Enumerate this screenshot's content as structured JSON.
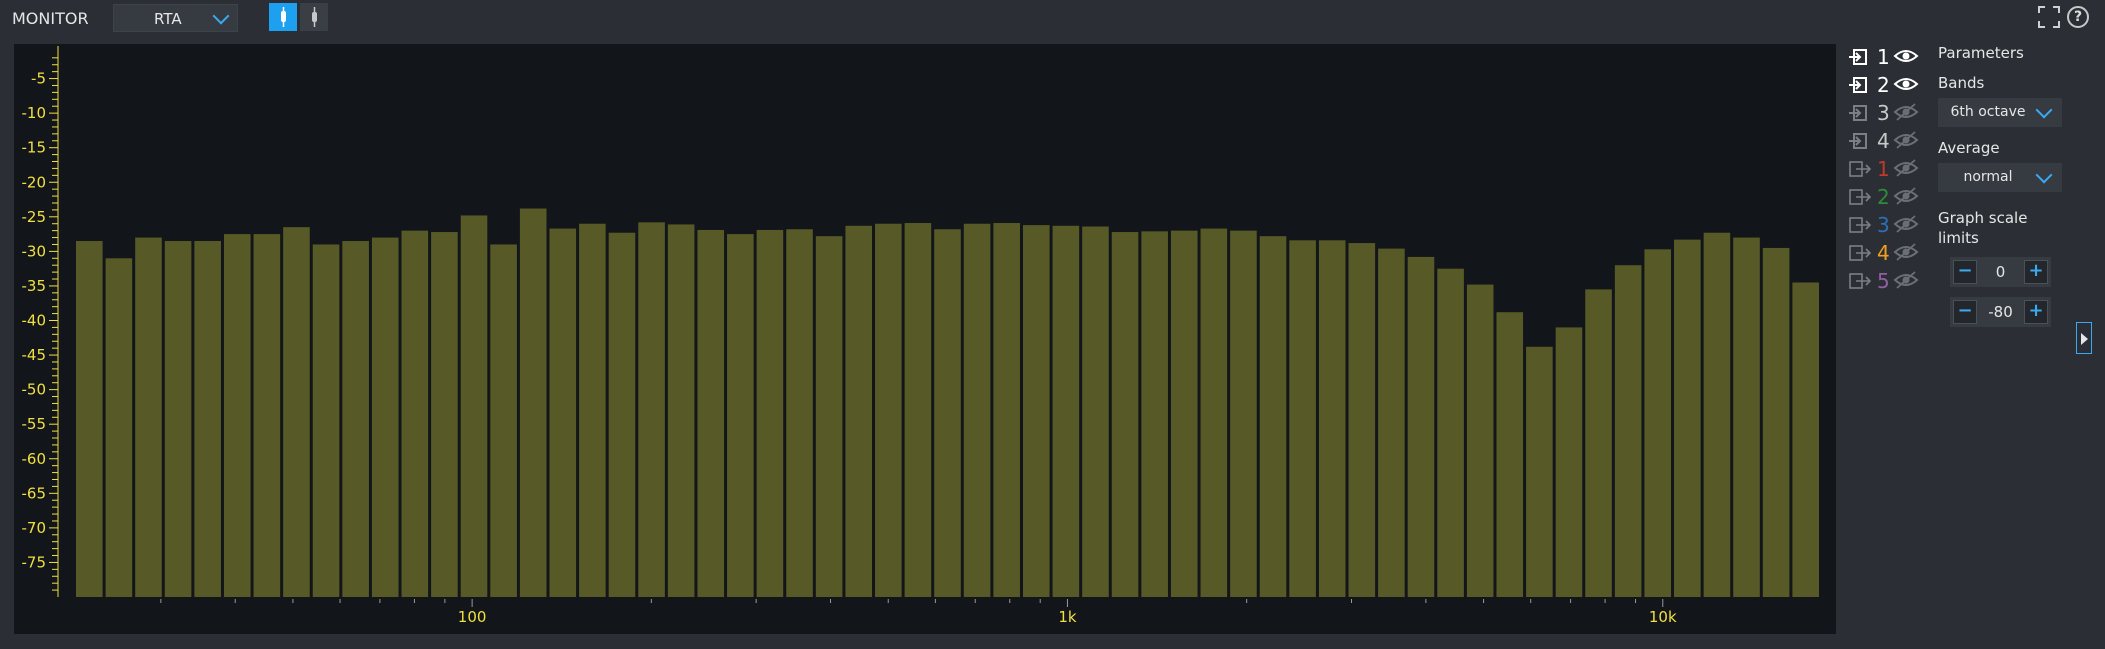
{
  "toolbar": {
    "title": "MONITOR",
    "mode": "RTA",
    "probe_modes": [
      "probe-single",
      "probe-dual"
    ],
    "fullscreen_icon": "fullscreen-icon",
    "help_label": "?"
  },
  "channels": [
    {
      "label": "1",
      "type": "input",
      "visible": true,
      "color": "#ffffff"
    },
    {
      "label": "2",
      "type": "input",
      "visible": true,
      "color": "#ffffff"
    },
    {
      "label": "3",
      "type": "input",
      "visible": false,
      "color": "#c8c8c8"
    },
    {
      "label": "4",
      "type": "input",
      "visible": false,
      "color": "#c8c8c8"
    },
    {
      "label": "1",
      "type": "output",
      "visible": false,
      "color": "#c0392b"
    },
    {
      "label": "2",
      "type": "output",
      "visible": false,
      "color": "#2e8b3a"
    },
    {
      "label": "3",
      "type": "output",
      "visible": false,
      "color": "#2e6fb5"
    },
    {
      "label": "4",
      "type": "output",
      "visible": false,
      "color": "#f0a020"
    },
    {
      "label": "5",
      "type": "output",
      "visible": false,
      "color": "#9060a0"
    }
  ],
  "params": {
    "title": "Parameters",
    "bands_label": "Bands",
    "bands_value": "6th octave",
    "average_label": "Average",
    "average_value": "normal",
    "scale_label_line1": "Graph scale",
    "scale_label_line2": "limits",
    "scale_max": "0",
    "scale_min": "-80",
    "minus_label": "−",
    "plus_label": "+"
  },
  "chart_data": {
    "type": "bar",
    "bar_color": "#575a26",
    "tick_color": "#f0e040",
    "y_ticks": [
      "-5",
      "-10",
      "-15",
      "-20",
      "-25",
      "-30",
      "-35",
      "-40",
      "-45",
      "-50",
      "-55",
      "-60",
      "-65",
      "-70",
      "-75"
    ],
    "x_labels": [
      "100",
      "1k",
      "10k"
    ],
    "ylim": [
      -80,
      0
    ],
    "x_scale": "log",
    "values": [
      -28.5,
      -31,
      -28,
      -28.5,
      -28.5,
      -27.5,
      -27.5,
      -26.5,
      -29,
      -28.5,
      -28,
      -27,
      -27.2,
      -24.8,
      -29,
      -23.8,
      -26.7,
      -26,
      -27.3,
      -25.8,
      -26.1,
      -26.9,
      -27.5,
      -26.9,
      -26.8,
      -27.8,
      -26.3,
      -26,
      -25.9,
      -26.8,
      -26,
      -25.9,
      -26.2,
      -26.3,
      -26.4,
      -27.2,
      -27.1,
      -27,
      -26.7,
      -27,
      -27.8,
      -28.4,
      -28.4,
      -28.8,
      -29.6,
      -30.8,
      -32.5,
      -34.8,
      -38.8,
      -43.8,
      -41,
      -35.5,
      -32,
      -29.7,
      -28.3,
      -27.3,
      -28,
      -29.5,
      -34.5
    ]
  }
}
